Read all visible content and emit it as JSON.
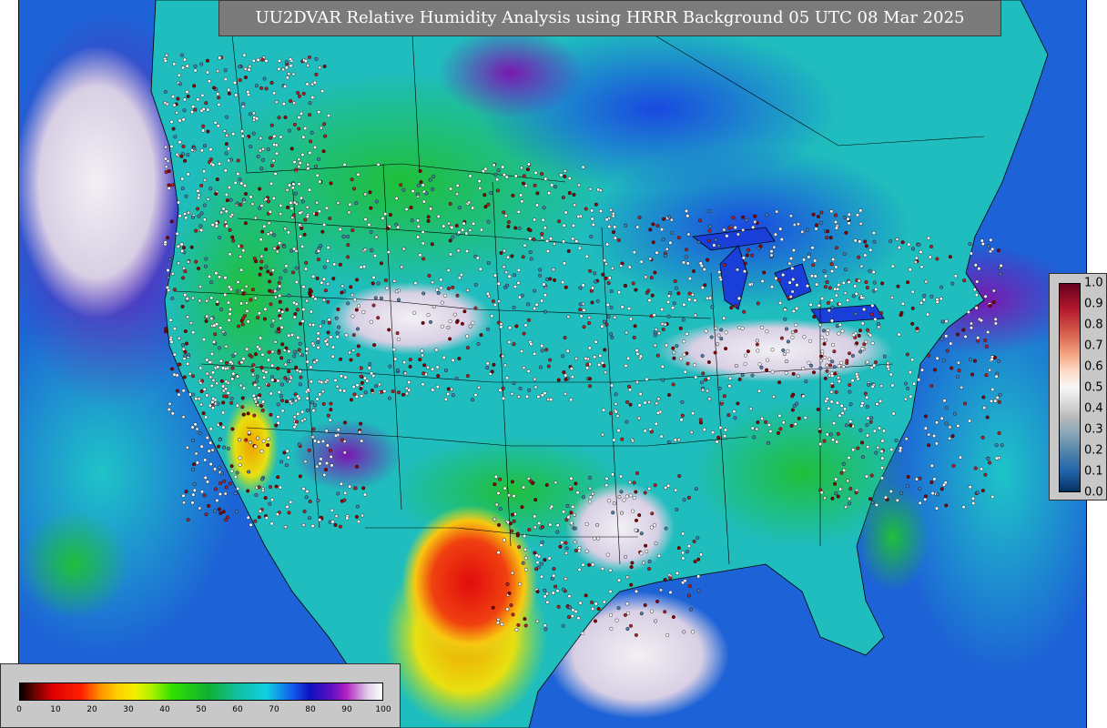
{
  "title": "UU2DVAR Relative Humidity Analysis using HRRR Background 05 UTC 08 Mar 2025",
  "colors": {
    "ocean_moist": "#1f5fd8",
    "ocean_dry": "#19b7c8",
    "land_mid": "#1ec0c0",
    "land_green": "#22c34a",
    "land_dry": "#e81010",
    "saturated": "#f0f0f0",
    "purple": "#8a1fb4",
    "outside": "#c8c8c8"
  },
  "rh_legend": {
    "ticks": [
      "0",
      "10",
      "20",
      "30",
      "40",
      "50",
      "60",
      "70",
      "80",
      "90",
      "100"
    ]
  },
  "increment_legend": {
    "ticks": [
      "1.0",
      "0.9",
      "0.8",
      "0.7",
      "0.6",
      "0.5",
      "0.4",
      "0.3",
      "0.2",
      "0.1",
      "0.0"
    ]
  }
}
